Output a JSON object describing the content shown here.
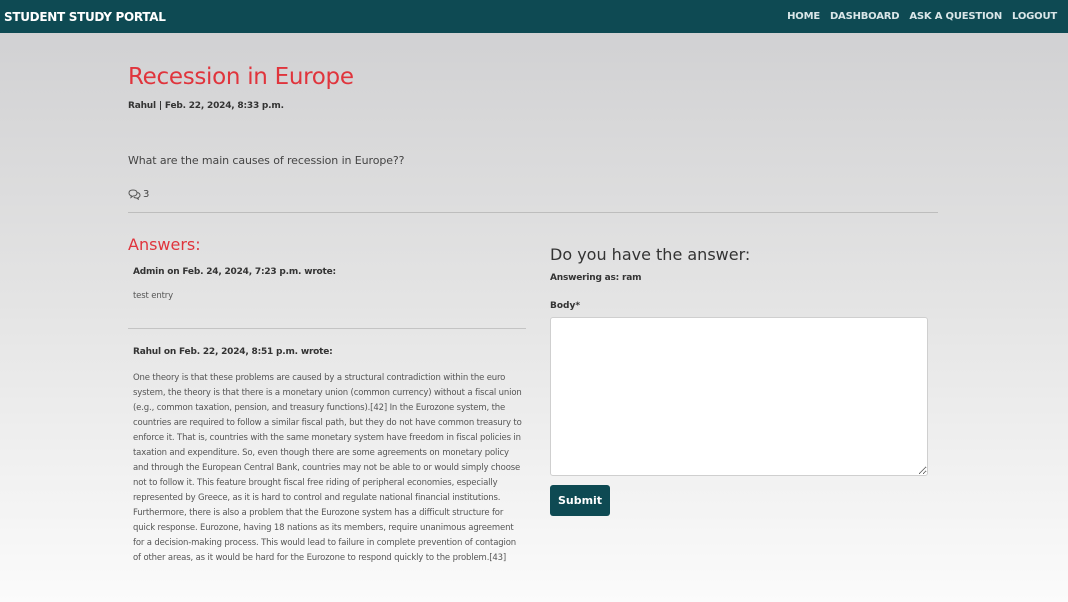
{
  "navbar": {
    "brand": "STUDENT STUDY PORTAL",
    "links": [
      {
        "label": "HOME"
      },
      {
        "label": "DASHBOARD"
      },
      {
        "label": "ASK A QUESTION"
      },
      {
        "label": "LOGOUT"
      }
    ],
    "color": "#0e4a53"
  },
  "question": {
    "title": "Recession in Europe",
    "meta": "Rahul | Feb. 22, 2024, 8:33 p.m.",
    "body": "What are the main causes of recession in Europe??",
    "comment_icon": "comments-icon",
    "comment_count": "3"
  },
  "answers": {
    "heading": "Answers:",
    "items": [
      {
        "meta": "Admin on Feb. 24, 2024, 7:23 p.m. wrote:",
        "body": "test entry"
      },
      {
        "meta": "Rahul on Feb. 22, 2024, 8:51 p.m. wrote:",
        "body": "One theory is that these problems are caused by a structural contradiction within the euro system, the theory is that there is a monetary union (common currency) without a fiscal union (e.g., common taxation, pension, and treasury functions).[42] In the Eurozone system, the countries are required to follow a similar fiscal path, but they do not have common treasury to enforce it. That is, countries with the same monetary system have freedom in fiscal policies in taxation and expenditure. So, even though there are some agreements on monetary policy and through the European Central Bank, countries may not be able to or would simply choose not to follow it. This feature brought fiscal free riding of peripheral economies, especially represented by Greece, as it is hard to control and regulate national financial institutions. Furthermore, there is also a problem that the Eurozone system has a difficult structure for quick response. Eurozone, having 18 nations as its members, require unanimous agreement for a decision-making process. This would lead to failure in complete prevention of contagion of other areas, as it would be hard for the Eurozone to respond quickly to the problem.[43]"
      }
    ]
  },
  "answer_form": {
    "heading": "Do you have the answer:",
    "answering_as": "Answering as: ram",
    "body_label": "Body*",
    "body_value": "",
    "submit_label": "Submit"
  },
  "colors": {
    "accent": "#e0343c",
    "primary": "#0e4a53"
  }
}
